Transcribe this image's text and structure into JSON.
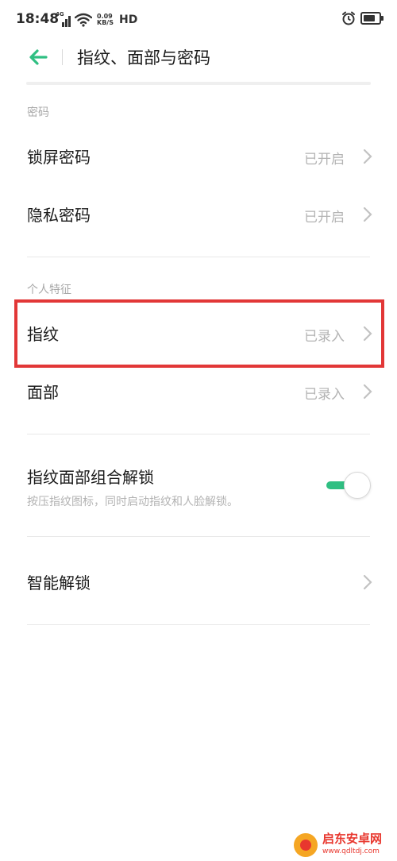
{
  "status_bar": {
    "time": "18:48",
    "network_tag": "4G",
    "speed_value": "0.09",
    "speed_unit": "KB/S",
    "hd_label": "HD",
    "icons": [
      "signal-icon",
      "wifi-icon",
      "alarm-icon",
      "battery-icon"
    ]
  },
  "header": {
    "title": "指纹、面部与密码",
    "back_icon": "back-arrow-icon",
    "accent_color": "#2fbf82"
  },
  "sections": {
    "password": {
      "label": "密码",
      "items": [
        {
          "label": "锁屏密码",
          "status": "已开启"
        },
        {
          "label": "隐私密码",
          "status": "已开启"
        }
      ]
    },
    "personal": {
      "label": "个人特征",
      "items": [
        {
          "label": "指纹",
          "status": "已录入"
        },
        {
          "label": "面部",
          "status": "已录入"
        }
      ]
    },
    "combo": {
      "label": "指纹面部组合解锁",
      "description": "按压指纹图标，同时启动指纹和人脸解锁。",
      "toggle_on": true
    },
    "smart": {
      "label": "智能解锁"
    }
  },
  "highlight_color": "#e23737",
  "watermark": {
    "name": "启东安卓网",
    "url": "www.qdltdj.com"
  }
}
